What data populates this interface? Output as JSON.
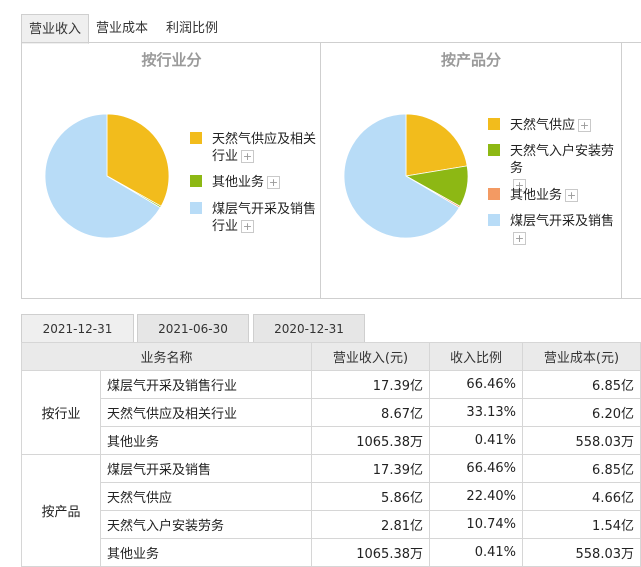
{
  "tabs": [
    "营业收入",
    "营业成本",
    "利润比例"
  ],
  "industry_chart": {
    "title": "按行业分",
    "legend": [
      {
        "label": "天然气供应及相关行业",
        "color": "#f2bc1c"
      },
      {
        "label": "其他业务",
        "color": "#8db814"
      },
      {
        "label": "煤层气开采及销售行业",
        "color": "#b8dcf7"
      }
    ]
  },
  "product_chart": {
    "title": "按产品分",
    "legend": [
      {
        "label": "天然气供应",
        "color": "#f2bc1c"
      },
      {
        "label": "天然气入户安装劳务",
        "color": "#8db814"
      },
      {
        "label": "其他业务",
        "color": "#f39a63"
      },
      {
        "label": "煤层气开采及销售",
        "color": "#b8dcf7"
      }
    ]
  },
  "plus": "+",
  "date_tabs": [
    "2021-12-31",
    "2021-06-30",
    "2020-12-31"
  ],
  "table": {
    "headers": [
      "业务名称",
      "营业收入(元)",
      "收入比例",
      "营业成本(元)"
    ],
    "groups": [
      {
        "name": "按行业",
        "rows": [
          [
            "煤层气开采及销售行业",
            "17.39亿",
            "66.46%",
            "6.85亿"
          ],
          [
            "天然气供应及相关行业",
            "8.67亿",
            "33.13%",
            "6.20亿"
          ],
          [
            "其他业务",
            "1065.38万",
            "0.41%",
            "558.03万"
          ]
        ]
      },
      {
        "name": "按产品",
        "rows": [
          [
            "煤层气开采及销售",
            "17.39亿",
            "66.46%",
            "6.85亿"
          ],
          [
            "天然气供应",
            "5.86亿",
            "22.40%",
            "4.66亿"
          ],
          [
            "天然气入户安装劳务",
            "2.81亿",
            "10.74%",
            "1.54亿"
          ],
          [
            "其他业务",
            "1065.38万",
            "0.41%",
            "558.03万"
          ]
        ]
      }
    ]
  },
  "chart_data": [
    {
      "type": "pie",
      "title": "按行业分",
      "categories": [
        "天然气供应及相关行业",
        "其他业务",
        "煤层气开采及销售行业"
      ],
      "values": [
        33.13,
        0.41,
        66.46
      ]
    },
    {
      "type": "pie",
      "title": "按产品分",
      "categories": [
        "天然气供应",
        "天然气入户安装劳务",
        "其他业务",
        "煤层气开采及销售"
      ],
      "values": [
        22.4,
        10.74,
        0.41,
        66.46
      ]
    }
  ]
}
